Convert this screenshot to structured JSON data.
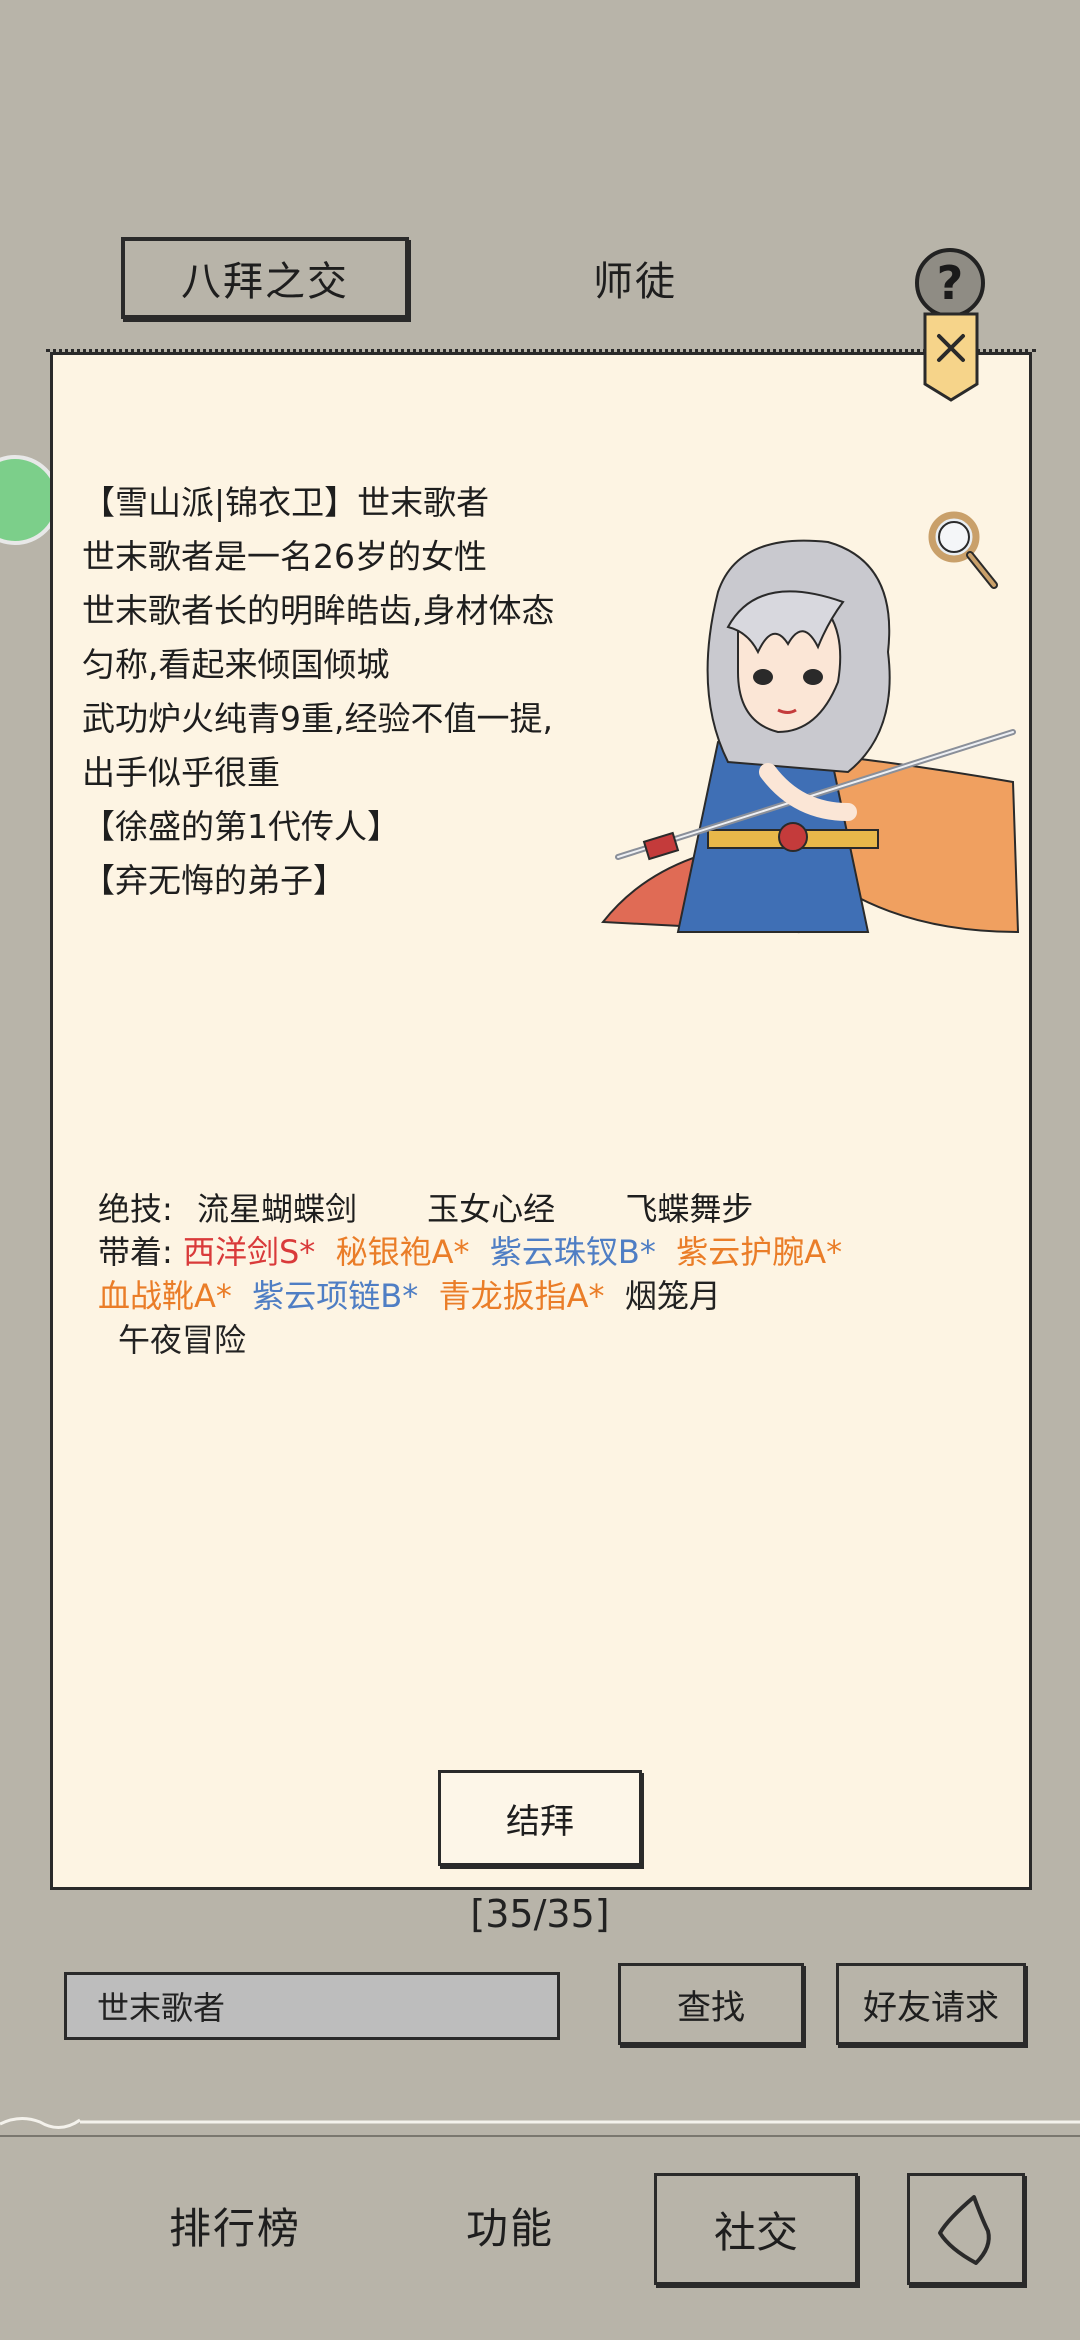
{
  "tabs": {
    "active": "八拜之交",
    "inactive": "师徒"
  },
  "help_label": "?",
  "character": {
    "lines": [
      "【雪山派|锦衣卫】世末歌者",
      "世末歌者是一名26岁的女性",
      "世末歌者长的明眸皓齿,身材体态",
      "匀称,看起来倾国倾城",
      "武功炉火纯青9重,经验不值一提,",
      "出手似乎很重",
      "【徐盛的第1代传人】",
      "【弃无悔的弟子】"
    ]
  },
  "skills": {
    "label": "绝技:",
    "items": [
      "流星蝴蝶剑",
      "玉女心经",
      "飞蝶舞步"
    ]
  },
  "equipment": {
    "label": "带着:",
    "items": [
      {
        "text": "西洋剑S*",
        "color": "#d93a3a"
      },
      {
        "text": "秘银袍A*",
        "color": "#ea7d28"
      },
      {
        "text": "紫云珠钗B*",
        "color": "#4f7ec4"
      },
      {
        "text": "紫云护腕A*",
        "color": "#ea7d28"
      },
      {
        "text": "血战靴A*",
        "color": "#ea7d28"
      },
      {
        "text": "紫云项链B*",
        "color": "#4f7ec4"
      },
      {
        "text": "青龙扳指A*",
        "color": "#ea7d28"
      },
      {
        "text": "烟笼月",
        "color": "#222222"
      },
      {
        "text": "午夜冒险",
        "color": "#222222"
      }
    ]
  },
  "sworn_button": "结拜",
  "counter": "[35/35]",
  "search": {
    "value": "世末歌者"
  },
  "find_button": "查找",
  "friend_button": "好友请求",
  "nav": {
    "rank": "排行榜",
    "function": "功能",
    "social": "社交"
  },
  "colors": {
    "background": "#b8b4a9",
    "panel": "#fdf4e3",
    "coin": "#7ccf8a"
  }
}
